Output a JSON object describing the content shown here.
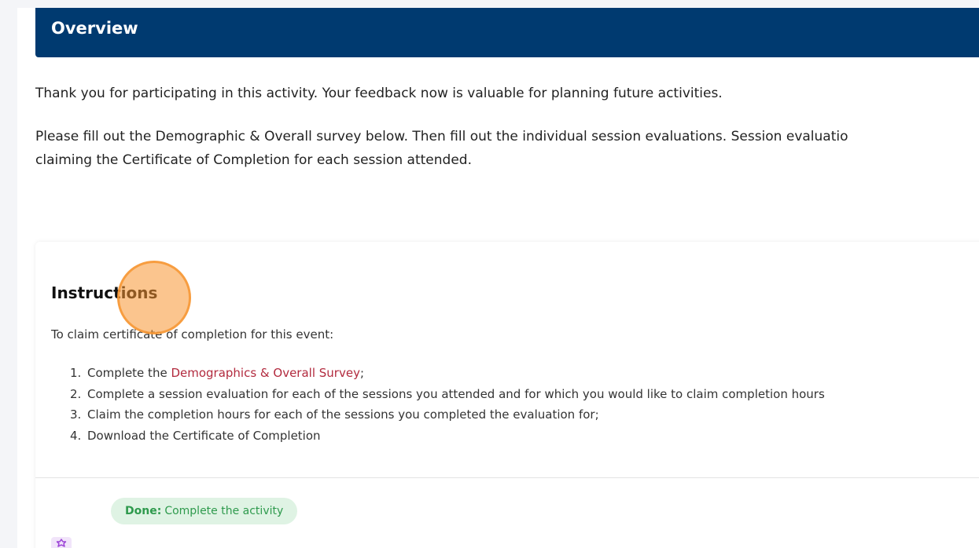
{
  "overview": {
    "title": "Overview"
  },
  "intro": {
    "paragraph1": "Thank you for participating in this activity. Your feedback now is valuable for planning future activities.",
    "paragraph2_line1": "Please fill out the Demographic & Overall survey below. Then fill out the individual session evaluations. Session evaluatio",
    "paragraph2_line2": "claiming the Certificate of Completion for each session attended."
  },
  "instructions": {
    "title": "Instructions",
    "subtitle": "To claim certificate of completion for this event:",
    "steps": [
      {
        "num": "1.",
        "prefix": "Complete the ",
        "link": "Demographics & Overall Survey",
        "suffix": ";"
      },
      {
        "num": "2.",
        "text": "Complete a session evaluation for each of the sessions you attended and for which you would like to claim completion hours"
      },
      {
        "num": "3.",
        "text": "Claim the completion hours for each of the sessions you completed the evaluation for;"
      },
      {
        "num": "4.",
        "text": "Download the Certificate of Completion"
      }
    ]
  },
  "status": {
    "done_label": "Done:",
    "done_text": "Complete the activity",
    "icon": "certificate-badge-icon"
  },
  "colors": {
    "header_bg": "#003a70",
    "link": "#b22a3e",
    "done_bg": "#dff3e4",
    "done_text": "#2e9a4d",
    "cursor_highlight": "#f79632"
  }
}
